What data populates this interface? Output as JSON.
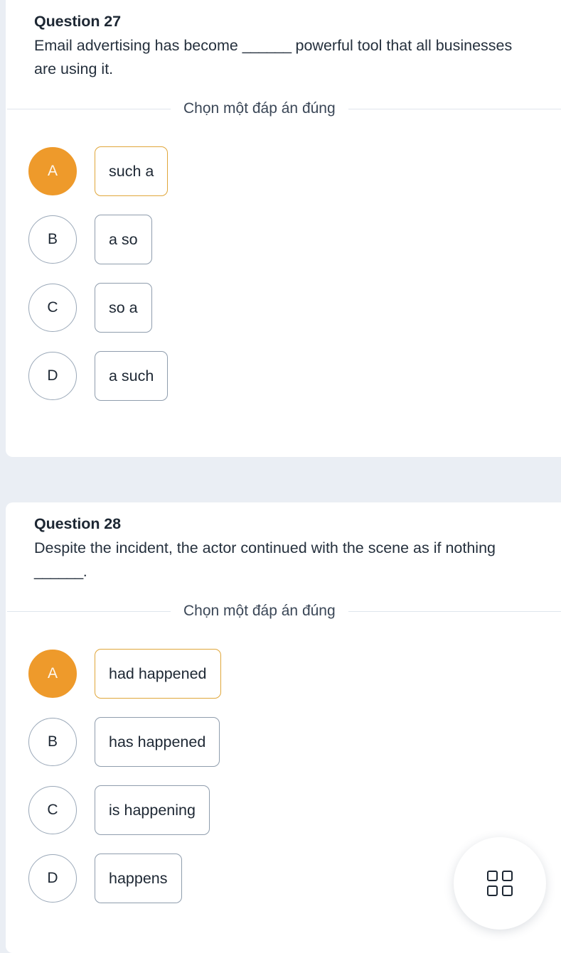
{
  "theme": {
    "page_background": "#eaeef4",
    "card_background": "#ffffff",
    "accent_orange": "#ee9a2b",
    "selected_border": "#e0a63a",
    "text_dark": "#1d2733",
    "border_gray": "#8f9dad",
    "divider": "#dfe5ed"
  },
  "questions": [
    {
      "heading": "Question 27",
      "prompt_before": "Email advertising has become ",
      "blank": "______",
      "prompt_after": " powerful tool that all businesses are using it.",
      "prompt_full": "Email advertising has become ______ powerful tool that all businesses are using it.",
      "instruction": "Chọn một đáp án đúng",
      "options": [
        {
          "letter": "A",
          "label": "such a",
          "selected": true
        },
        {
          "letter": "B",
          "label": "a so",
          "selected": false
        },
        {
          "letter": "C",
          "label": "so a",
          "selected": false
        },
        {
          "letter": "D",
          "label": "a such",
          "selected": false
        }
      ]
    },
    {
      "heading": "Question 28",
      "prompt_before": "Despite the incident, the actor continued with the scene as if nothing ",
      "blank": "______",
      "prompt_after": ".",
      "prompt_full": "Despite the incident, the actor continued with the scene as if nothing ______.",
      "instruction": "Chọn một đáp án đúng",
      "options": [
        {
          "letter": "A",
          "label": "had happened",
          "selected": true
        },
        {
          "letter": "B",
          "label": "has happened",
          "selected": false
        },
        {
          "letter": "C",
          "label": "is happening",
          "selected": false
        },
        {
          "letter": "D",
          "label": "happens",
          "selected": false
        }
      ]
    }
  ],
  "floating_button": {
    "icon": "grid-four-squares-icon",
    "label": ""
  }
}
